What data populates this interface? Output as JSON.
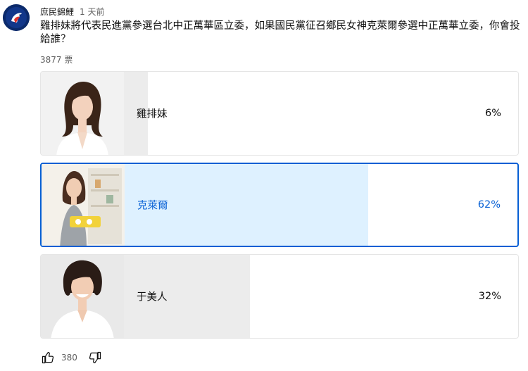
{
  "post": {
    "channel_name": "庶民錦鯉",
    "time_ago": "1 天前",
    "question": "雞排妹將代表民進黨參選台北中正萬華區立委，如果國民黨征召鄉民女神克萊爾參選中正萬華立委，你會投給誰？",
    "vote_count": "3877 票",
    "like_count": "380"
  },
  "poll": {
    "options": [
      {
        "label": "雞排妹",
        "percent_text": "6%",
        "percent": 6,
        "selected": false
      },
      {
        "label": "克萊爾",
        "percent_text": "62%",
        "percent": 62,
        "selected": true
      },
      {
        "label": "于美人",
        "percent_text": "32%",
        "percent": 32,
        "selected": false
      }
    ]
  },
  "icons": {
    "like": "thumbs-up-icon",
    "dislike": "thumbs-down-icon"
  },
  "colors": {
    "accent": "#065fd4",
    "selected_fill": "#def1ff",
    "bar_fill": "#ececec"
  }
}
